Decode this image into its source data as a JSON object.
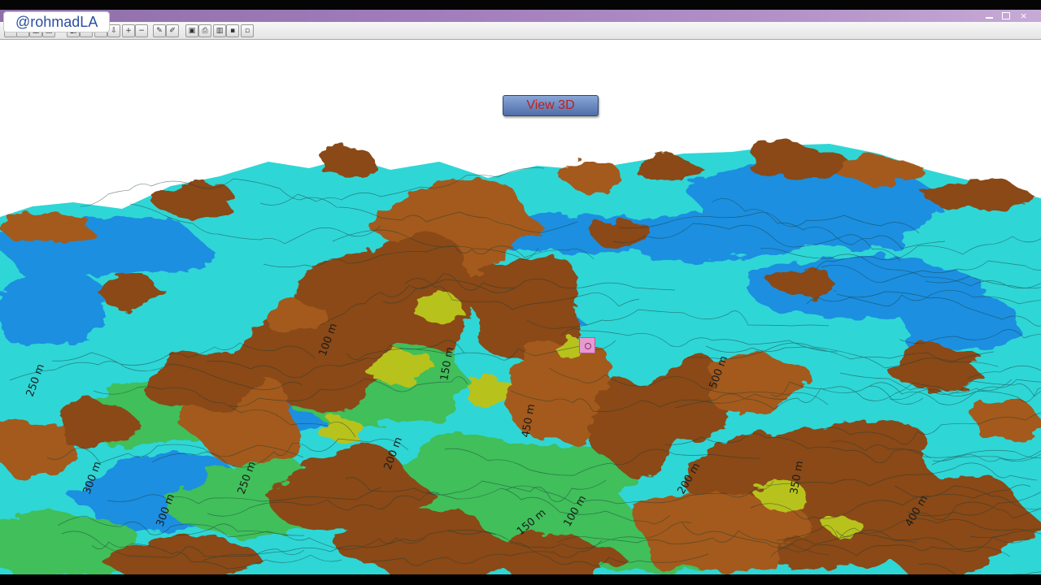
{
  "watermark": {
    "text": "@rohmadLA"
  },
  "toolbar": {
    "buttons": [
      {
        "name": "select-tool-icon",
        "glyph": "↖"
      },
      {
        "name": "pan-tool-icon",
        "glyph": "✥"
      },
      {
        "name": "layer-tool-icon",
        "glyph": "▦"
      },
      {
        "name": "grid-tool-icon",
        "glyph": "▤"
      },
      {
        "name": "marker-tool-icon",
        "glyph": "◧"
      },
      {
        "name": "info-tool-icon",
        "glyph": "i"
      },
      {
        "name": "arrow-up-icon",
        "glyph": "⇧"
      },
      {
        "name": "arrow-down-icon",
        "glyph": "⇩"
      },
      {
        "name": "zoom-in-icon",
        "glyph": "+"
      },
      {
        "name": "zoom-out-icon",
        "glyph": "−"
      },
      {
        "name": "edit-tool-icon",
        "glyph": "✎"
      },
      {
        "name": "draw-tool-icon",
        "glyph": "✐"
      },
      {
        "name": "image-tool-icon",
        "glyph": "▣"
      },
      {
        "name": "print-tool-icon",
        "glyph": "⎙"
      },
      {
        "name": "export-tool-icon",
        "glyph": "▥"
      },
      {
        "name": "save-icon",
        "glyph": "▪"
      },
      {
        "name": "settings-icon",
        "glyph": "▫"
      }
    ]
  },
  "viewport": {
    "button_label": "View 3D",
    "colors": {
      "ridge": "#8a4a16",
      "ridge_light": "#a35a1c",
      "lowland": "#2fd6d6",
      "valley": "#1f8fe0",
      "midland": "#3fbf5a",
      "highlight": "#b8c21e"
    },
    "contour_labels": [
      "100 m",
      "150 m",
      "200 m",
      "250 m",
      "300 m",
      "350 m",
      "400 m",
      "450 m",
      "500 m"
    ]
  }
}
